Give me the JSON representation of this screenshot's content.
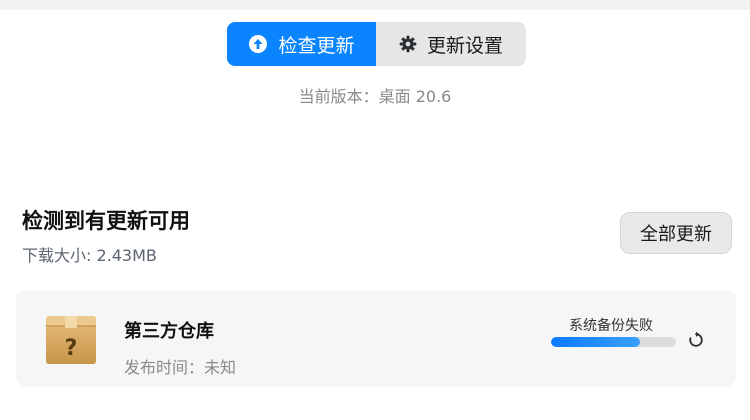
{
  "tabs": {
    "check_label": "检查更新",
    "settings_label": "更新设置"
  },
  "version_text": "当前版本：桌面 20.6",
  "updates": {
    "title": "检测到有更新可用",
    "download_size": "下载大小: 2.43MB",
    "update_all_label": "全部更新"
  },
  "items": [
    {
      "name": "第三方仓库",
      "date": "发布时间：未知",
      "status": "系统备份失败",
      "progress": 0.71,
      "icon": "package-box-question-icon"
    }
  ],
  "colors": {
    "accent": "#0a84ff",
    "inactive_tab": "#e6e6e6",
    "card": "#f6f6f6"
  }
}
